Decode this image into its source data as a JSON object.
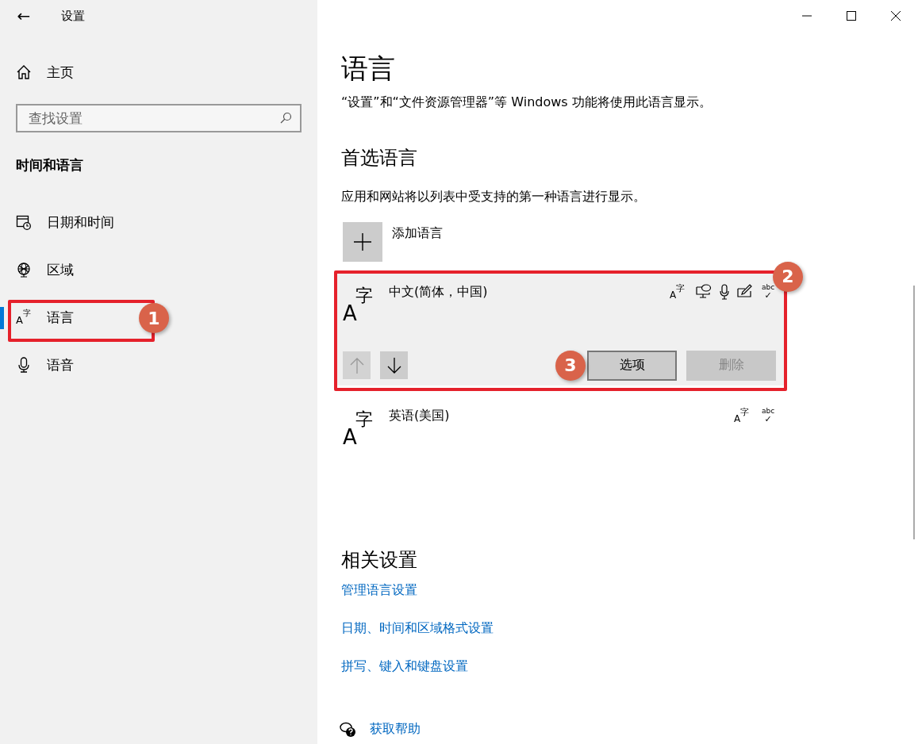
{
  "window": {
    "title": "设置",
    "back": "←"
  },
  "sidebar": {
    "home": "主页",
    "search": {
      "placeholder": "查找设置"
    },
    "section": "时间和语言",
    "items": [
      {
        "kind": "datetime",
        "label": "日期和时间",
        "selected": false,
        "highlighted": false
      },
      {
        "kind": "region",
        "label": "区域",
        "selected": false,
        "highlighted": false
      },
      {
        "kind": "language",
        "label": "语言",
        "selected": true,
        "highlighted": true,
        "callout": "1",
        "glyph": [
          "A",
          "字"
        ]
      },
      {
        "kind": "speech",
        "label": "语音",
        "selected": false,
        "highlighted": false
      }
    ]
  },
  "main": {
    "title": "语言",
    "description": "“设置”和“文件资源管理器”等 Windows 功能将使用此语言显示。",
    "preferred": {
      "heading": "首选语言",
      "description": "应用和网站将以列表中受支持的第一种语言进行显示。",
      "add": "添加语言",
      "languages": [
        {
          "name": "中文(简体，中国)",
          "glyph": [
            "A",
            "字"
          ],
          "expanded": true,
          "highlighted": true,
          "callout": "2",
          "features": [
            {
              "kind": "display",
              "text": [
                "A",
                "字"
              ]
            },
            {
              "kind": "tts"
            },
            {
              "kind": "speech"
            },
            {
              "kind": "handwriting"
            },
            {
              "kind": "spelling",
              "text": [
                "abc",
                "✓"
              ]
            }
          ],
          "move_up": {
            "disabled": true
          },
          "move_down": {
            "disabled": false
          },
          "options": {
            "label": "选项",
            "callout": "3",
            "disabled": false
          },
          "remove": {
            "label": "删除",
            "disabled": true
          }
        },
        {
          "name": "英语(美国)",
          "glyph": [
            "A",
            "字"
          ],
          "expanded": false,
          "highlighted": false,
          "features": [
            {
              "kind": "display",
              "text": [
                "A",
                "字"
              ]
            },
            {
              "kind": "spelling",
              "text": [
                "abc",
                "✓"
              ]
            }
          ]
        }
      ]
    },
    "related": {
      "heading": "相关设置",
      "links": [
        "管理语言设置",
        "日期、时间和区域格式设置",
        "拼写、键入和键盘设置"
      ]
    },
    "help": "获取帮助"
  }
}
